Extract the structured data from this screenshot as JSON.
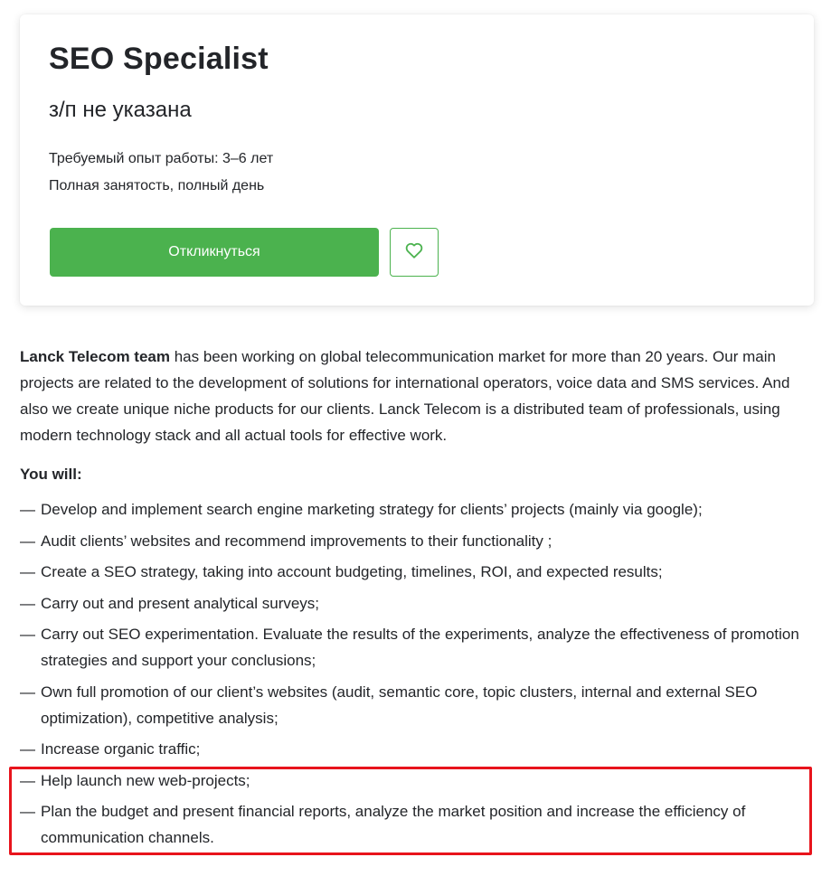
{
  "vacancy": {
    "title": "SEO Specialist",
    "salary": "з/п не указана",
    "experience": "Требуемый опыт работы: 3–6 лет",
    "employment": "Полная занятость, полный день",
    "respond_label": "Откликнуться",
    "favorite_icon": "heart-icon"
  },
  "description": {
    "company_name": "Lanck Telecom team",
    "intro_rest": " has been working on global telecommunication market for more than 20 years. Our main projects are related to the development of solutions for international operators, voice data and SMS services. And also we create unique niche products for our clients. Lanck Telecom is a distributed team of professionals, using modern technology stack and all actual tools for effective work.",
    "you_will_heading": "You will:",
    "dash": "—",
    "tasks": [
      "Develop and implement search engine marketing strategy for clients’ projects (mainly via google);",
      "Audit clients’ websites and recommend improvements to their functionality ;",
      "Create a SEO strategy, taking into account budgeting, timelines, ROI, and expected results;",
      "Carry out and present analytical surveys;",
      "Carry out SEO experimentation. Evaluate the results of the experiments, analyze the effectiveness of promotion strategies and support your conclusions;",
      "Own full promotion of our client’s websites (audit, semantic core, topic clusters, internal and external SEO optimization), competitive analysis;",
      "Increase organic traffic;",
      "Help launch new web-projects;",
      "Plan the budget and present financial reports, analyze the market position and increase the efficiency of communication channels."
    ]
  },
  "colors": {
    "accent_green": "#4bb24e",
    "highlight_red": "#e8141c",
    "text": "#232529"
  }
}
